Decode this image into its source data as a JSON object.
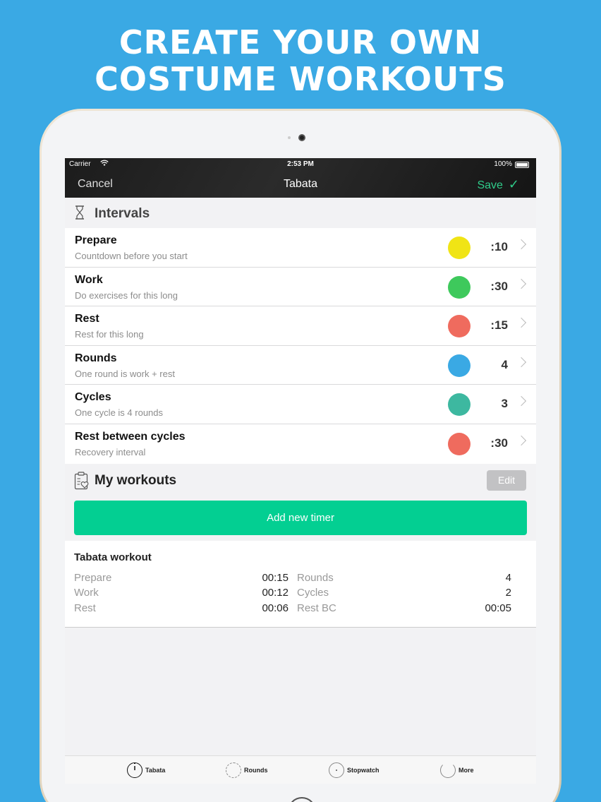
{
  "headline": {
    "line1": "CREATE YOUR OWN",
    "line2": "COSTUME WORKOUTS"
  },
  "status_bar": {
    "carrier": "Carrier",
    "time": "2:53 PM",
    "battery": "100%"
  },
  "navbar": {
    "cancel_label": "Cancel",
    "title": "Tabata",
    "save_label": "Save"
  },
  "intervals": {
    "title": "Intervals",
    "items": [
      {
        "name": "Prepare",
        "subtitle": "Countdown before you start",
        "value": ":10",
        "color": "#f0e415"
      },
      {
        "name": "Work",
        "subtitle": "Do exercises for this long",
        "value": ":30",
        "color": "#3ec95c"
      },
      {
        "name": "Rest",
        "subtitle": "Rest for this long",
        "value": ":15",
        "color": "#ef6b5e"
      },
      {
        "name": "Rounds",
        "subtitle": "One round is work + rest",
        "value": "4",
        "color": "#3aa9e4"
      },
      {
        "name": "Cycles",
        "subtitle": "One cycle is 4 rounds",
        "value": "3",
        "color": "#3db8a0"
      },
      {
        "name": "Rest between cycles",
        "subtitle": "Recovery interval",
        "value": ":30",
        "color": "#ef6b5e"
      }
    ]
  },
  "my_workouts": {
    "title": "My workouts",
    "edit_label": "Edit",
    "add_label": "Add new timer",
    "workout": {
      "title": "Tabata workout",
      "rows": [
        {
          "label_left": "Prepare",
          "value_left": "00:15",
          "label_right": "Rounds",
          "value_right": "4"
        },
        {
          "label_left": "Work",
          "value_left": "00:12",
          "label_right": "Cycles",
          "value_right": "2"
        },
        {
          "label_left": "Rest",
          "value_left": "00:06",
          "label_right": "Rest BC",
          "value_right": "00:05"
        }
      ]
    }
  },
  "tabbar": {
    "tabs": [
      {
        "label": "Tabata",
        "icon": "stopwatch-icon",
        "active": true
      },
      {
        "label": "Rounds",
        "icon": "rounds-icon",
        "active": false
      },
      {
        "label": "Stopwatch",
        "icon": "stopwatch-dial-icon",
        "active": false
      },
      {
        "label": "More",
        "icon": "more-icon",
        "active": false
      }
    ]
  },
  "colors": {
    "background": "#3aa9e4",
    "accent_green": "#03cf92",
    "save_green": "#2fcc8a"
  }
}
